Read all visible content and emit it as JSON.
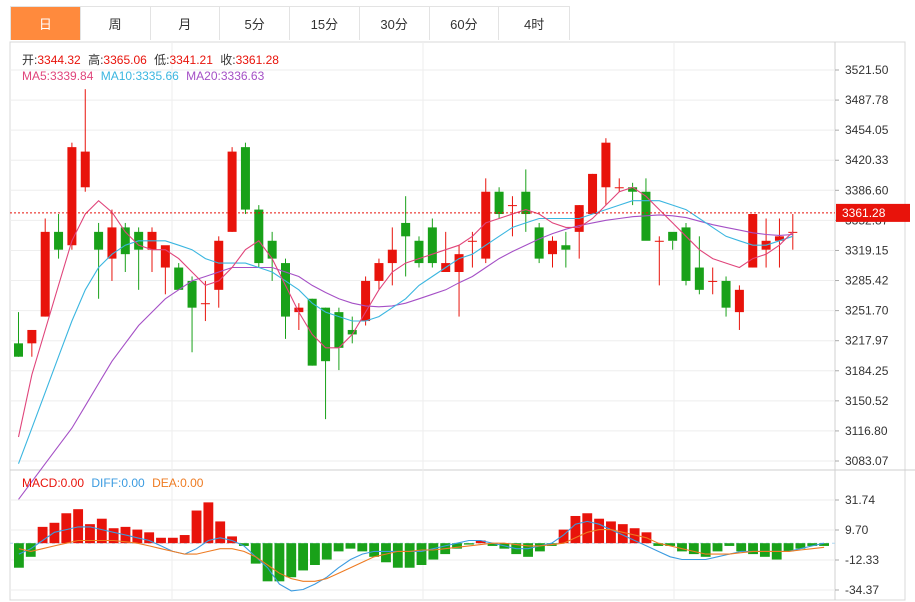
{
  "tabs": [
    {
      "label": "日",
      "active": true
    },
    {
      "label": "周",
      "active": false
    },
    {
      "label": "月",
      "active": false
    },
    {
      "label": "5分",
      "active": false
    },
    {
      "label": "15分",
      "active": false
    },
    {
      "label": "30分",
      "active": false
    },
    {
      "label": "60分",
      "active": false
    },
    {
      "label": "4时",
      "active": false
    }
  ],
  "ohlc_legend": {
    "open_label": "开:",
    "open": "3344.32",
    "high_label": "高:",
    "high": "3365.06",
    "low_label": "低:",
    "low": "3341.21",
    "close_label": "收:",
    "close": "3361.28"
  },
  "ma_legend": {
    "ma5_label": "MA5:",
    "ma5": "3339.84",
    "ma10_label": "MA10:",
    "ma10": "3335.66",
    "ma20_label": "MA20:",
    "ma20": "3336.63"
  },
  "macd_legend": {
    "macd_label": "MACD:",
    "macd": "0.00",
    "diff_label": "DIFF:",
    "diff": "0.00",
    "dea_label": "DEA:",
    "dea": "0.00"
  },
  "colors": {
    "up": "#e8130b",
    "down": "#19a119",
    "ma5": "#e0457b",
    "ma10": "#3bb6e0",
    "ma20": "#a550c6",
    "diff": "#3b9be0",
    "dea": "#ee7b22",
    "tab_active": "#ff8a3d",
    "price_tag": "#e8130b"
  },
  "chart_data": [
    {
      "type": "candlestick",
      "y_ticks": [
        "3521.50",
        "3487.78",
        "3454.05",
        "3420.33",
        "3386.60",
        "3352.87",
        "3319.15",
        "3285.42",
        "3251.70",
        "3217.97",
        "3184.25",
        "3150.52",
        "3116.80",
        "3083.07"
      ],
      "ylim": [
        3065,
        3545
      ],
      "last_price_label": "3361.28",
      "candles": [
        [
          3215,
          3250,
          3200,
          3200
        ],
        [
          3215,
          3230,
          3200,
          3230
        ],
        [
          3245,
          3355,
          3245,
          3340
        ],
        [
          3340,
          3360,
          3310,
          3320
        ],
        [
          3325,
          3440,
          3320,
          3435
        ],
        [
          3390,
          3500,
          3385,
          3430
        ],
        [
          3340,
          3350,
          3265,
          3320
        ],
        [
          3310,
          3365,
          3285,
          3345
        ],
        [
          3345,
          3350,
          3295,
          3315
        ],
        [
          3340,
          3345,
          3275,
          3320
        ],
        [
          3320,
          3345,
          3295,
          3340
        ],
        [
          3300,
          3320,
          3270,
          3325
        ],
        [
          3300,
          3305,
          3275,
          3275
        ],
        [
          3285,
          3290,
          3205,
          3255
        ],
        [
          3260,
          3285,
          3240,
          3260
        ],
        [
          3275,
          3335,
          3255,
          3330
        ],
        [
          3340,
          3435,
          3340,
          3430
        ],
        [
          3435,
          3440,
          3360,
          3365
        ],
        [
          3365,
          3370,
          3300,
          3305
        ],
        [
          3330,
          3340,
          3285,
          3310
        ],
        [
          3305,
          3310,
          3220,
          3245
        ],
        [
          3250,
          3260,
          3230,
          3255
        ],
        [
          3265,
          3265,
          3190,
          3190
        ],
        [
          3255,
          3255,
          3130,
          3195
        ],
        [
          3250,
          3255,
          3185,
          3210
        ],
        [
          3230,
          3245,
          3215,
          3225
        ],
        [
          3240,
          3290,
          3235,
          3285
        ],
        [
          3285,
          3310,
          3275,
          3305
        ],
        [
          3305,
          3345,
          3280,
          3320
        ],
        [
          3350,
          3380,
          3290,
          3335
        ],
        [
          3330,
          3335,
          3300,
          3305
        ],
        [
          3345,
          3355,
          3300,
          3305
        ],
        [
          3295,
          3340,
          3295,
          3305
        ],
        [
          3295,
          3325,
          3245,
          3315
        ],
        [
          3330,
          3340,
          3300,
          3330
        ],
        [
          3310,
          3400,
          3305,
          3385
        ],
        [
          3385,
          3390,
          3355,
          3360
        ],
        [
          3370,
          3380,
          3335,
          3370
        ],
        [
          3385,
          3410,
          3340,
          3360
        ],
        [
          3345,
          3350,
          3305,
          3310
        ],
        [
          3315,
          3335,
          3300,
          3330
        ],
        [
          3325,
          3340,
          3300,
          3320
        ],
        [
          3340,
          3370,
          3310,
          3370
        ],
        [
          3360,
          3405,
          3360,
          3405
        ],
        [
          3390,
          3445,
          3370,
          3440
        ],
        [
          3390,
          3400,
          3385,
          3390
        ],
        [
          3390,
          3395,
          3370,
          3385
        ],
        [
          3385,
          3400,
          3335,
          3330
        ],
        [
          3330,
          3335,
          3280,
          3330
        ],
        [
          3340,
          3330,
          3320,
          3330
        ],
        [
          3345,
          3350,
          3280,
          3285
        ],
        [
          3300,
          3335,
          3270,
          3275
        ],
        [
          3285,
          3300,
          3270,
          3285
        ],
        [
          3285,
          3290,
          3245,
          3255
        ],
        [
          3250,
          3280,
          3230,
          3275
        ],
        [
          3300,
          3360,
          3300,
          3360
        ],
        [
          3320,
          3355,
          3300,
          3330
        ],
        [
          3330,
          3355,
          3300,
          3335
        ],
        [
          3340,
          3360,
          3320,
          3340
        ]
      ],
      "ma5": [
        3110,
        3180,
        3230,
        3280,
        3330,
        3360,
        3375,
        3362,
        3340,
        3325,
        3320,
        3320,
        3310,
        3295,
        3280,
        3285,
        3300,
        3320,
        3330,
        3310,
        3280,
        3250,
        3225,
        3210,
        3210,
        3225,
        3250,
        3275,
        3295,
        3305,
        3310,
        3315,
        3320,
        3325,
        3335,
        3350,
        3355,
        3360,
        3365,
        3360,
        3350,
        3345,
        3345,
        3355,
        3370,
        3385,
        3390,
        3380,
        3365,
        3350,
        3335,
        3320,
        3310,
        3305,
        3300,
        3310,
        3315,
        3325,
        3340
      ],
      "ma10": [
        3080,
        3120,
        3160,
        3200,
        3240,
        3275,
        3300,
        3315,
        3325,
        3330,
        3330,
        3330,
        3325,
        3320,
        3310,
        3305,
        3305,
        3305,
        3300,
        3295,
        3285,
        3275,
        3260,
        3250,
        3245,
        3240,
        3240,
        3245,
        3255,
        3265,
        3280,
        3290,
        3300,
        3310,
        3315,
        3325,
        3335,
        3345,
        3350,
        3355,
        3355,
        3355,
        3355,
        3360,
        3365,
        3370,
        3375,
        3375,
        3375,
        3370,
        3365,
        3355,
        3345,
        3335,
        3330,
        3325,
        3325,
        3330,
        3335
      ],
      "ma20": [
        3040,
        3060,
        3080,
        3100,
        3120,
        3145,
        3170,
        3195,
        3215,
        3235,
        3250,
        3265,
        3275,
        3285,
        3290,
        3295,
        3300,
        3300,
        3300,
        3300,
        3295,
        3290,
        3280,
        3272,
        3265,
        3260,
        3257,
        3256,
        3257,
        3260,
        3265,
        3270,
        3275,
        3283,
        3290,
        3300,
        3310,
        3318,
        3325,
        3332,
        3338,
        3343,
        3347,
        3350,
        3353,
        3355,
        3357,
        3358,
        3359,
        3358,
        3356,
        3352,
        3348,
        3345,
        3342,
        3339,
        3337,
        3336,
        3337
      ]
    },
    {
      "type": "macd",
      "y_ticks": [
        "31.74",
        "9.70",
        "-12.33",
        "-34.37"
      ],
      "ylim": [
        -42,
        42
      ],
      "histogram": [
        -18,
        -10,
        12,
        15,
        22,
        25,
        14,
        18,
        11,
        12,
        10,
        8,
        4,
        4,
        6,
        24,
        30,
        16,
        5,
        -2,
        -15,
        -28,
        -28,
        -25,
        -20,
        -16,
        -12,
        -6,
        -4,
        -6,
        -10,
        -14,
        -18,
        -18,
        -16,
        -12,
        -8,
        -4,
        -1,
        2,
        -2,
        -4,
        -8,
        -10,
        -6,
        -2,
        10,
        20,
        22,
        18,
        16,
        14,
        11,
        8,
        -2,
        -2,
        -6,
        -8,
        -10,
        -6,
        -2,
        -6,
        -8,
        -10,
        -12,
        -6,
        -4,
        -2,
        -2
      ],
      "diff": [
        -8,
        -4,
        2,
        8,
        10,
        12,
        12,
        10,
        8,
        6,
        4,
        2,
        -2,
        -6,
        -8,
        -4,
        2,
        4,
        2,
        -2,
        -10,
        -18,
        -30,
        -35,
        -34,
        -30,
        -25,
        -18,
        -12,
        -8,
        -6,
        -6,
        -6,
        -6,
        -6,
        -4,
        -2,
        0,
        2,
        2,
        0,
        -2,
        -4,
        -4,
        -2,
        0,
        6,
        14,
        16,
        14,
        10,
        6,
        2,
        -2,
        -6,
        -10,
        -12,
        -12,
        -12,
        -10,
        -8,
        -6,
        -6,
        -6,
        -6,
        -6,
        -4,
        -2,
        0
      ],
      "dea": [
        -4,
        -6,
        -4,
        -2,
        0,
        2,
        2,
        2,
        2,
        1,
        0,
        -2,
        -4,
        -6,
        -8,
        -8,
        -6,
        -4,
        -4,
        -6,
        -10,
        -16,
        -22,
        -26,
        -28,
        -28,
        -26,
        -22,
        -18,
        -14,
        -10,
        -8,
        -6,
        -6,
        -5,
        -5,
        -4,
        -3,
        -2,
        -1,
        0,
        0,
        -1,
        -2,
        -2,
        -1,
        0,
        4,
        8,
        10,
        10,
        8,
        6,
        4,
        0,
        -2,
        -4,
        -6,
        -8,
        -8,
        -8,
        -7,
        -6,
        -6,
        -6,
        -6,
        -5,
        -4,
        -3
      ]
    }
  ]
}
